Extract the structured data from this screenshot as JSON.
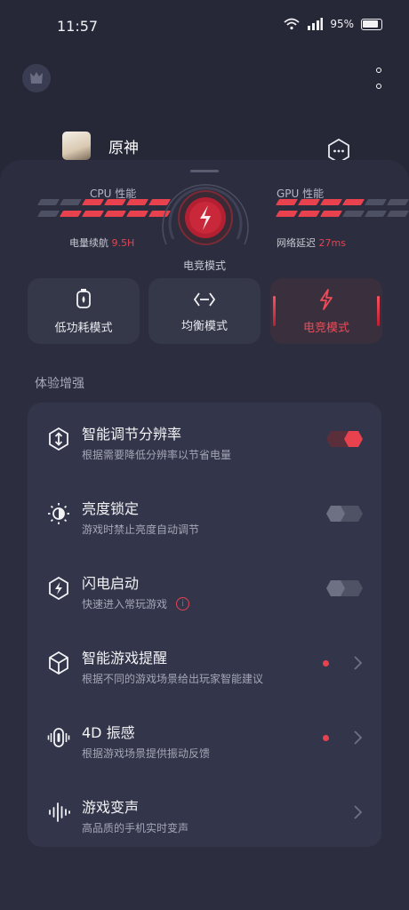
{
  "status": {
    "time": "11:57",
    "battery": "95%"
  },
  "game": {
    "name": "原神"
  },
  "perf": {
    "cpu_label": "CPU 性能",
    "gpu_label": "GPU 性能",
    "battery_label": "电量续航",
    "battery_value": "9.5H",
    "latency_label": "网络延迟",
    "latency_value": "27ms",
    "current_mode": "电竞模式",
    "cpu_level": [
      0.6,
      0.83
    ],
    "gpu_level": [
      0.67,
      0.5
    ]
  },
  "modes": [
    {
      "label": "低功耗模式",
      "icon": "low-power-icon",
      "active": false
    },
    {
      "label": "均衡模式",
      "icon": "balance-icon",
      "active": false
    },
    {
      "label": "电竞模式",
      "icon": "lightning-icon",
      "active": true
    }
  ],
  "section_title": "体验增强",
  "items": [
    {
      "title": "智能调节分辨率",
      "desc": "根据需要降低分辨率以节省电量",
      "control": "toggle",
      "on": true,
      "icon": "resolution-icon"
    },
    {
      "title": "亮度锁定",
      "desc": "游戏时禁止亮度自动调节",
      "control": "toggle",
      "on": false,
      "icon": "brightness-icon"
    },
    {
      "title": "闪电启动",
      "desc": "快速进入常玩游戏",
      "control": "toggle",
      "on": false,
      "info": "i",
      "icon": "lightning-launch-icon"
    },
    {
      "title": "智能游戏提醒",
      "desc": "根据不同的游戏场景给出玩家智能建议",
      "control": "chevron",
      "badge": true,
      "icon": "game-reminder-icon"
    },
    {
      "title": "4D 振感",
      "desc": "根据游戏场景提供振动反馈",
      "control": "chevron",
      "badge": true,
      "icon": "vibration-icon"
    },
    {
      "title": "游戏变声",
      "desc": "高品质的手机实时变声",
      "control": "chevron",
      "badge": false,
      "icon": "voice-change-icon"
    }
  ],
  "colors": {
    "accent": "#e8424f",
    "background": "#262838",
    "sheet": "#2c2e3f",
    "panel": "#33364a"
  }
}
